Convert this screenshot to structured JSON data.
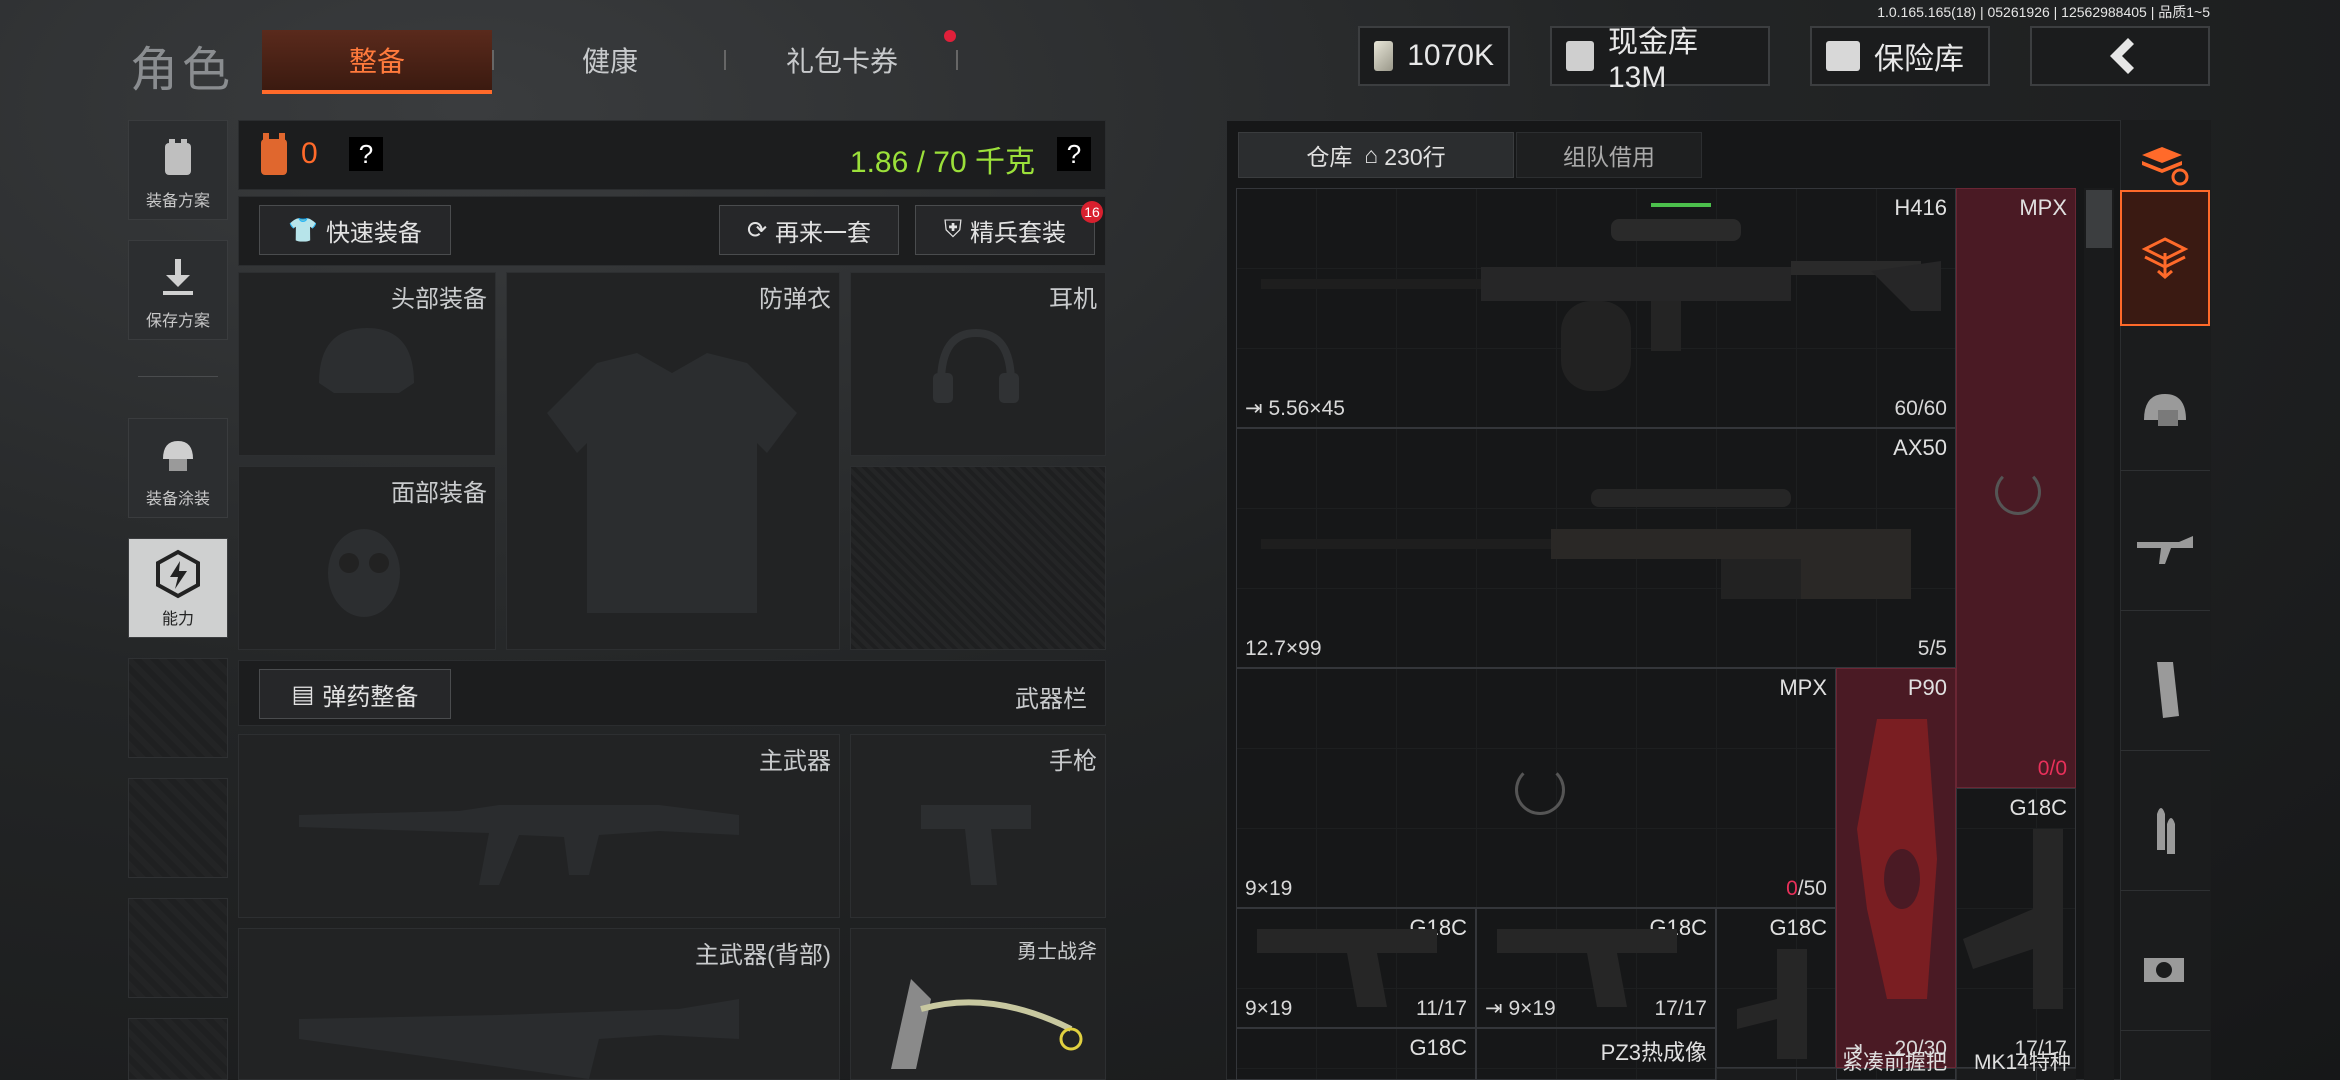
{
  "version": "1.0.165.165(18) | 05261926 | 12562988405 | 品质1~5",
  "title": "角色",
  "tabs": [
    {
      "label": "整备",
      "active": true
    },
    {
      "label": "健康",
      "active": false
    },
    {
      "label": "礼包卡券",
      "active": false,
      "has_dot": true
    }
  ],
  "currency": {
    "money": "1070K",
    "cash_vault": "现金库 13M",
    "safe": "保险库"
  },
  "side_menu": [
    {
      "label": "装备方案",
      "icon": "vest-icon"
    },
    {
      "label": "保存方案",
      "icon": "download-icon"
    },
    {
      "label": "装备涂装",
      "icon": "helmet-paint-icon"
    },
    {
      "label": "能力",
      "icon": "ability-icon",
      "active": true
    }
  ],
  "loadout": {
    "armor_count": "0",
    "weight": "1.86 / 70 千克",
    "help": "?",
    "quick_equip": "快速装备",
    "again": "再来一套",
    "elite": "精兵套装",
    "elite_badge": "16",
    "slots": {
      "head": "头部装备",
      "vest": "防弹衣",
      "headset": "耳机",
      "face": "面部装备"
    },
    "ammo_btn": "弹药整备",
    "weapon_bar": "武器栏",
    "primary": "主武器",
    "pistol": "手枪",
    "primary_back": "主武器(背部)",
    "melee": "勇士战斧"
  },
  "storage": {
    "tab_warehouse": "仓库",
    "rows": "230行",
    "tab_team": "组队借用",
    "items": [
      {
        "name": "H416",
        "ammo": "5.56×45",
        "count": "60/60"
      },
      {
        "name": "MPX",
        "ammo": "",
        "count": ""
      },
      {
        "name": "AX50",
        "ammo": "12.7×99",
        "count": "5/5"
      },
      {
        "name": "MPX",
        "ammo": "9×19",
        "count_red": "0",
        "count_rest": "/50"
      },
      {
        "name": "P90",
        "ammo": "",
        "count": "20/30"
      },
      {
        "name": "",
        "count_red": "0",
        "count_rest": "/0"
      },
      {
        "name": "G18C",
        "ammo": "",
        "count": "17/17"
      },
      {
        "name": "G18C",
        "ammo": "9×19",
        "count": "11/17"
      },
      {
        "name": "G18C",
        "ammo": "9×19",
        "count": "17/17"
      },
      {
        "name": "G18C",
        "ammo": "",
        "count": ""
      },
      {
        "name": "G18C",
        "ammo": "",
        "count": ""
      },
      {
        "name": "PZ3热成像",
        "ammo": "",
        "count": ""
      },
      {
        "name": "紧凑前握把",
        "ammo": "",
        "count": ""
      },
      {
        "name": "MK14特种",
        "ammo": "",
        "count": ""
      }
    ]
  },
  "colors": {
    "accent": "#ff6a2a",
    "weight_green": "#9be03a",
    "red_slot": "#4a1a24"
  }
}
